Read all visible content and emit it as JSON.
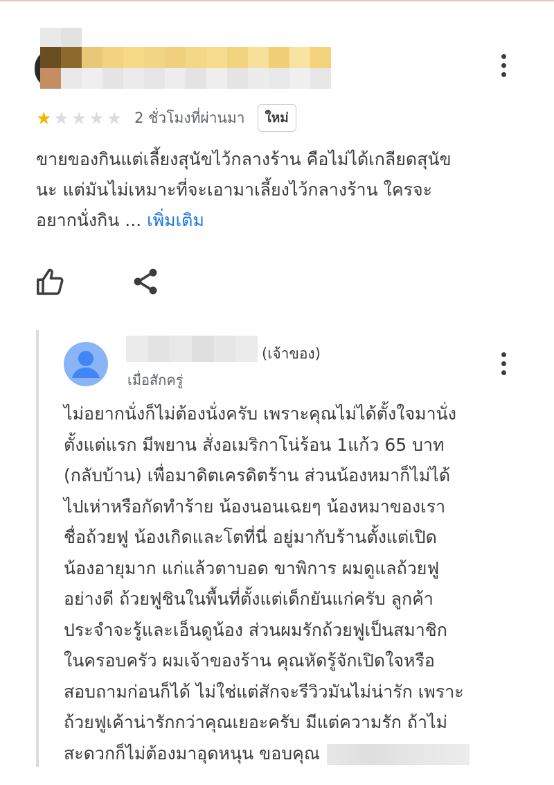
{
  "review": {
    "rating_stars": 1,
    "rating_max": 5,
    "time_ago": "2 ชั่วโมงที่ผ่านมา",
    "badge": "ใหม่",
    "text_lines": [
      "ขายของกินแต่เลี้ยงสุนัขไว้กลางร้าน คือไม่ได้เกลียดสุนัข",
      "นะ แต่มันไม่เหมาะที่จะเอามาเลี้ยงไว้กลางร้าน ใครจะ",
      "อยากนั่งกิน ... "
    ],
    "more_label": "เพิ่มเติม",
    "like_icon": "thumbs-up-icon",
    "share_icon": "share-icon",
    "more_icon": "more-vert-icon"
  },
  "owner_reply": {
    "label": "(เจ้าของ)",
    "time_ago": "เมื่อสักครู่",
    "avatar_icon": "person-icon",
    "text_lines": [
      "ไม่อยากนั่งก็ไม่ต้องนั่งครับ เพราะคุณไม่ได้ตั้งใจมานั่ง",
      "ตั้งแต่แรก มีพยาน สั่งอเมริกาโน่ร้อน 1แก้ว 65 บาท",
      "(กลับบ้าน) เพื่อมาดิตเครดิตร้าน ส่วนน้องหมาก็ไม่ได้",
      "ไปเห่าหรือกัดทำร้าย น้องนอนเฉยๆ น้องหมาของเรา",
      "ชื่อถ้วยฟู น้องเกิดและโตที่นี่ อยู่มากับร้านตั้งแต่เปิด",
      "น้องอายุมาก แก่แล้วตาบอด ขาพิการ ผมดูแลถ้วยฟู",
      "อย่างดี ถ้วยฟูชินในพื้นที่ตั้งแต่เด็กยันแก่ครับ ลูกค้า",
      "ประจำจะรู้และเอ็นดูน้อง ส่วนผมรักถ้วยฟูเป็นสมาชิก",
      "ในครอบครัว ผมเจ้าของร้าน คุณหัดรู้จักเปิดใจหรือ",
      "สอบถามก่อนก็ได้ ไม่ใช่แต่สักจะรีวิวมันไม่น่ารัก เพราะ",
      "ถ้วยฟูเค้าน่ารักกว่าคุณเยอะครับ มีแต่ความรัก ถ้าไม่",
      "สะดวกก็ไม่ต้องมาอุดหนุน ขอบคุณ"
    ]
  },
  "colors": {
    "star_filled": "#f5b400",
    "star_empty": "#dadce0",
    "link": "#1a73e8",
    "avatar_bg": "#8ab4f8",
    "avatar_fg": "#4285f4"
  }
}
